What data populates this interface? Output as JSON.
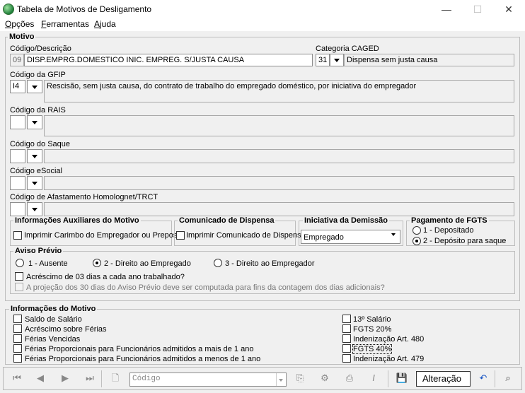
{
  "window": {
    "title": "Tabela de Motivos de Desligamento",
    "minimize": "—",
    "maximize": "☐",
    "close": "✕"
  },
  "menu": {
    "opcoes_rest": "pções",
    "opcoes_key": "O",
    "ferramentas_key": "F",
    "ferramentas_rest": "erramentas",
    "ajuda_key": "A",
    "ajuda_rest": "juda"
  },
  "motivo": {
    "group_title": "Motivo",
    "codigo_label": "Código/Descrição",
    "codigo": "09",
    "descricao": "DISP.EMPRG.DOMESTICO INIC. EMPREG. S/JUSTA CAUSA",
    "caged_label": "Categoria CAGED",
    "caged_code": "31",
    "caged_desc": "Dispensa sem justa causa",
    "gfip_label": "Código da GFIP",
    "gfip_code": "I4",
    "gfip_desc": "Rescisão, sem justa causa, do contrato de trabalho do empregado doméstico, por iniciativa do empregador",
    "rais_label": "Código da RAIS",
    "rais_code": "",
    "rais_desc": "",
    "saque_label": "Código do Saque",
    "saque_code": "",
    "saque_desc": "",
    "esocial_label": "Código eSocial",
    "esocial_code": "",
    "esocial_desc": "",
    "afast_label": "Código de Afastamento Homolognet/TRCT",
    "afast_code": "",
    "afast_desc": ""
  },
  "info_aux": {
    "title": "Informações Auxiliares do Motivo",
    "carimbo_label": "Imprimir Carimbo do Empregador ou Preposto",
    "carimbo_checked": false
  },
  "comunicado": {
    "title": "Comunicado de Dispensa",
    "imprimir_label": "Imprimir Comunicado de Dispensa",
    "imprimir_checked": false
  },
  "iniciativa": {
    "title": "Iniciativa da Demissão",
    "value": "Empregado"
  },
  "fgts": {
    "title": "Pagamento de FGTS",
    "opt1": "1 - Depositado",
    "opt2": "2 - Depósito para saque",
    "selected": 2
  },
  "aviso": {
    "title": "Aviso Prévio",
    "opt1": "1 - Ausente",
    "opt2": "2 - Direito ao Empregado",
    "opt3": "3 - Direito ao Empregador",
    "selected": 2,
    "acrescimo_label": "Acréscimo de 03 dias a cada ano trabalhado?",
    "projecao_label": "A projeção dos 30 dias do Aviso Prévio deve ser computada para fins da contagem dos dias adicionais?"
  },
  "info_motivo": {
    "title": "Informações do Motivo",
    "left": [
      "Saldo de Salário",
      "Acréscimo sobre Férias",
      "Férias Vencidas",
      "Férias Proporcionais para Funcionários admitidos a mais de 1 ano",
      "Férias Proporcionais para Funcionários admitidos a menos de 1 ano"
    ],
    "right": [
      "13º Salário",
      "FGTS 20%",
      "Indenização Art. 480",
      "FGTS 40%",
      "Indenização Art. 479"
    ]
  },
  "toolbar": {
    "first": "first-record-icon",
    "search_placeholder": "Código",
    "mode": "Alteração"
  }
}
